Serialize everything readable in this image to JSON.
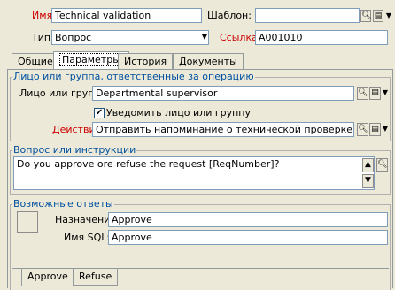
{
  "header": {
    "name_label": "Имя:",
    "name_value": "Technical validation",
    "template_label": "Шаблон:",
    "template_value": "",
    "type_label": "Тип:",
    "type_value": "Вопрос",
    "ref_label": "Ссылка:",
    "ref_value": "A001010"
  },
  "tabs": [
    {
      "label": "Общие",
      "active": false
    },
    {
      "label": "Параметры",
      "active": true
    },
    {
      "label": "История",
      "active": false
    },
    {
      "label": "Документы",
      "active": false
    }
  ],
  "responsible": {
    "title": "Лицо или группа, ответственные за операцию",
    "person_label": "Лицо или группа:",
    "person_value": "Departmental supervisor",
    "notify_label": "Уведомить лицо или группу",
    "notify_checked": true,
    "action_label": "Действие:",
    "action_value": "Отправить напоминание о технической проверке"
  },
  "question": {
    "title": "Вопрос или инструкции",
    "text": "Do you approve ore refuse the request [ReqNumber]?"
  },
  "answers": {
    "title": "Возможные ответы",
    "purpose_label": "Назначение:",
    "purpose_value": "Approve",
    "sql_label": "Имя SQL:",
    "sql_value": "Approve",
    "tabs": [
      {
        "label": "Approve",
        "active": true
      },
      {
        "label": "Refuse",
        "active": false
      }
    ]
  }
}
